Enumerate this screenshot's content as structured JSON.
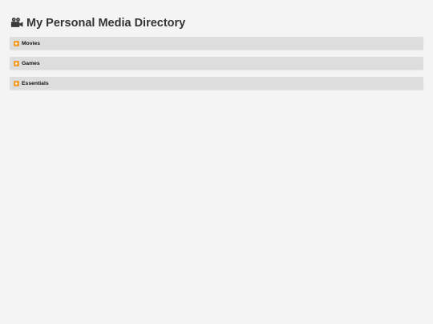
{
  "page": {
    "title_icon": "movie-camera-icon",
    "title": "My Personal Media Directory"
  },
  "folders": [
    {
      "label": "Movies",
      "icon": "expand-arrow-icon"
    },
    {
      "label": "Games",
      "icon": "expand-arrow-icon"
    },
    {
      "label": "Essentials",
      "icon": "expand-arrow-icon"
    }
  ],
  "colors": {
    "background": "#f4f4f4",
    "folder_bar": "#dddddd",
    "toggle_icon": "#f0a030",
    "title_text": "#333333"
  }
}
